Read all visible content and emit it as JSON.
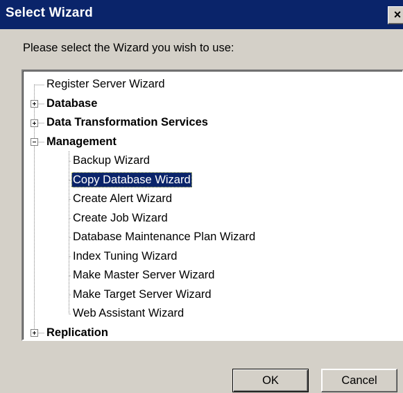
{
  "window": {
    "title": "Select Wizard",
    "close_label": "×"
  },
  "prompt": "Please select the Wizard you wish to use:",
  "tree": {
    "items": [
      {
        "label": "Register Server Wizard",
        "level": 0,
        "expander": "none",
        "bold": false,
        "selected": false
      },
      {
        "label": "Database",
        "level": 0,
        "expander": "plus",
        "bold": true,
        "selected": false
      },
      {
        "label": "Data Transformation Services",
        "level": 0,
        "expander": "plus",
        "bold": true,
        "selected": false
      },
      {
        "label": "Management",
        "level": 0,
        "expander": "minus",
        "bold": true,
        "selected": false
      },
      {
        "label": "Backup Wizard",
        "level": 1,
        "expander": "none",
        "bold": false,
        "selected": false
      },
      {
        "label": "Copy Database Wizard",
        "level": 1,
        "expander": "none",
        "bold": false,
        "selected": true
      },
      {
        "label": "Create Alert Wizard",
        "level": 1,
        "expander": "none",
        "bold": false,
        "selected": false
      },
      {
        "label": "Create Job Wizard",
        "level": 1,
        "expander": "none",
        "bold": false,
        "selected": false
      },
      {
        "label": "Database Maintenance Plan Wizard",
        "level": 1,
        "expander": "none",
        "bold": false,
        "selected": false
      },
      {
        "label": "Index Tuning Wizard",
        "level": 1,
        "expander": "none",
        "bold": false,
        "selected": false
      },
      {
        "label": "Make Master Server Wizard",
        "level": 1,
        "expander": "none",
        "bold": false,
        "selected": false
      },
      {
        "label": "Make Target Server Wizard",
        "level": 1,
        "expander": "none",
        "bold": false,
        "selected": false
      },
      {
        "label": "Web Assistant Wizard",
        "level": 1,
        "expander": "none",
        "bold": false,
        "selected": false
      },
      {
        "label": "Replication",
        "level": 0,
        "expander": "plus",
        "bold": true,
        "selected": false
      }
    ]
  },
  "buttons": {
    "ok_label": "OK",
    "cancel_label": "Cancel"
  },
  "colors": {
    "titlebar": "#0a246a",
    "dialog_face": "#d4d0c8",
    "selection": "#0a246a"
  }
}
